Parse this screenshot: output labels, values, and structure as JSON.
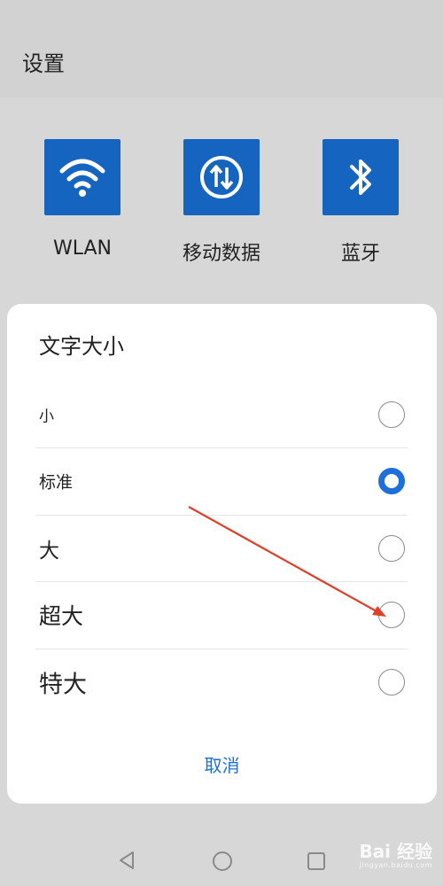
{
  "header": {
    "title": "设置"
  },
  "tiles": [
    {
      "icon": "wifi-icon",
      "label": "WLAN"
    },
    {
      "icon": "mobile-data-icon",
      "label": "移动数据"
    },
    {
      "icon": "bluetooth-icon",
      "label": "蓝牙"
    }
  ],
  "dialog": {
    "title": "文字大小",
    "options": [
      {
        "label": "小",
        "selected": false
      },
      {
        "label": "标准",
        "selected": true
      },
      {
        "label": "大",
        "selected": false
      },
      {
        "label": "超大",
        "selected": false
      },
      {
        "label": "特大",
        "selected": false
      }
    ],
    "cancel_label": "取消"
  },
  "colors": {
    "accent": "#1e6fd9",
    "tile": "#1565c0",
    "annotation_arrow": "#e0402a"
  },
  "navbar": {
    "icons": [
      "back-icon",
      "home-icon",
      "recents-icon"
    ]
  },
  "watermark": {
    "main": "Bai 经验",
    "sub": "jingyan.baidu.com"
  }
}
